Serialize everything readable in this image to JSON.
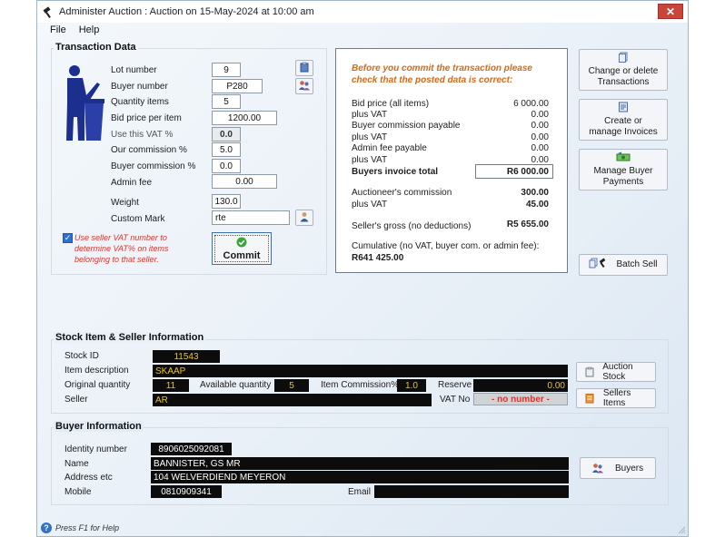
{
  "window": {
    "title": "Administer Auction : Auction on 15-May-2024 at 10:00 am",
    "close": "✕"
  },
  "menu": [
    "File",
    "Help"
  ],
  "transaction": {
    "title": "Transaction Data",
    "fields": {
      "lot_number": {
        "label": "Lot number",
        "value": "9"
      },
      "buyer_number": {
        "label": "Buyer number",
        "value": "P280"
      },
      "quantity_items": {
        "label": "Quantity items",
        "value": "5"
      },
      "bid_price": {
        "label": "Bid price per item",
        "value": "1200.00"
      },
      "use_vat": {
        "label": "Use this VAT %",
        "value": "0.0"
      },
      "our_commission": {
        "label": "Our commission %",
        "value": "5.0"
      },
      "buyer_commission": {
        "label": "Buyer commission %",
        "value": "0.0"
      },
      "admin_fee": {
        "label": "Admin fee",
        "value": "0.00"
      },
      "weight": {
        "label": "Weight",
        "value": "130.0"
      },
      "custom_mark": {
        "label": "Custom Mark",
        "value": "rte"
      }
    },
    "seller_vat_note": "Use seller VAT number to determine VAT% on items belonging to that seller.",
    "commit_label": "Commit"
  },
  "summary": {
    "warning": "Before you commit the transaction please check that the posted data is correct:",
    "rows": [
      {
        "label": "Bid price (all items)",
        "value": "6 000.00"
      },
      {
        "label": "plus VAT",
        "value": "0.00"
      },
      {
        "label": "Buyer commission payable",
        "value": "0.00"
      },
      {
        "label": "plus VAT",
        "value": "0.00"
      },
      {
        "label": "Admin fee payable",
        "value": "0.00"
      },
      {
        "label": "plus VAT",
        "value": "0.00"
      }
    ],
    "buyers_total_label": "Buyers invoice total",
    "buyers_total_value": "R6 000.00",
    "auctioneer_commission_label": "Auctioneer's commission",
    "auctioneer_commission_value": "300.00",
    "auctioneer_vat_label": "plus VAT",
    "auctioneer_vat_value": "45.00",
    "sellers_gross_label": "Seller's gross (no deductions)",
    "sellers_gross_value": "R5 655.00",
    "cumulative_label": "Cumulative (no VAT, buyer com. or admin fee):",
    "cumulative_value": "R641 425.00"
  },
  "side_buttons": {
    "change_delete": "Change or delete Transactions",
    "create_invoices": "Create or manage Invoices",
    "buyer_payments": "Manage Buyer Payments",
    "batch_sell": "Batch Sell"
  },
  "stock": {
    "title": "Stock Item & Seller Information",
    "stock_id_label": "Stock ID",
    "stock_id": "11543",
    "description_label": "Item description",
    "description": "SKAAP",
    "orig_qty_label": "Original quantity",
    "orig_qty": "11",
    "avail_qty_label": "Available quantity",
    "avail_qty": "5",
    "item_commission_label": "Item Commission%",
    "item_commission": "1.0",
    "reserve_label": "Reserve",
    "reserve": "0.00",
    "seller_label": "Seller",
    "seller": "AR",
    "vat_no_label": "VAT No",
    "vat_no": "- no number -",
    "auction_stock_button": "Auction Stock",
    "sellers_items_button": "Sellers Items"
  },
  "buyer": {
    "title": "Buyer Information",
    "identity_label": "Identity number",
    "identity": "8906025092081",
    "name_label": "Name",
    "name": "BANNISTER, GS MR",
    "address_label": "Address etc",
    "address": "104 WELVERDIEND MEYERON",
    "mobile_label": "Mobile",
    "mobile": "0810909341",
    "email_label": "Email",
    "email": "",
    "buyers_button": "Buyers"
  },
  "status": {
    "help": "Press F1 for Help"
  },
  "colors": {
    "accent": "#2d6fd3",
    "warning": "#d26a1a",
    "error": "#d8342b",
    "dark_field": "#0c0c0c",
    "dark_text": "#f0c419"
  }
}
